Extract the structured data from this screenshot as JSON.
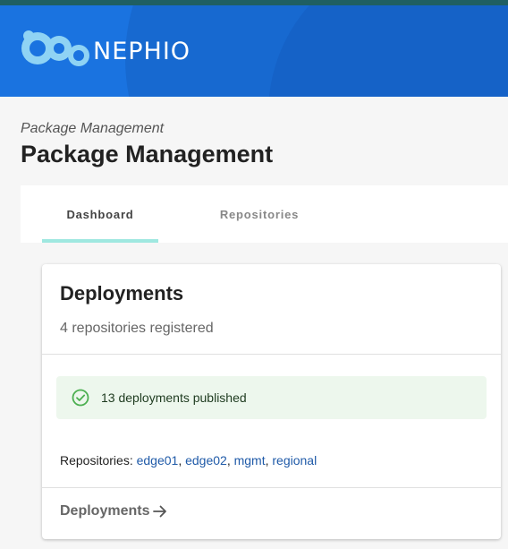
{
  "header": {
    "brand": "NEPHIO",
    "logo_icon": "nephio-bubbles-logo",
    "colors": {
      "background": "#1a73e0",
      "strip": "#1f5f62"
    }
  },
  "page": {
    "breadcrumb": "Package Management",
    "title": "Package Management"
  },
  "tabs": [
    {
      "label": "Dashboard",
      "active": true
    },
    {
      "label": "Repositories",
      "active": false
    }
  ],
  "card": {
    "title": "Deployments",
    "subtitle": "4 repositories registered",
    "alert": {
      "icon": "check-circle-icon",
      "text": "13 deployments published",
      "color": "#4caf50"
    },
    "repositories_label": "Repositories:",
    "repositories": [
      "edge01",
      "edge02",
      "mgmt",
      "regional"
    ],
    "footer_link": {
      "label": "Deployments",
      "icon": "arrow-right-icon"
    }
  }
}
